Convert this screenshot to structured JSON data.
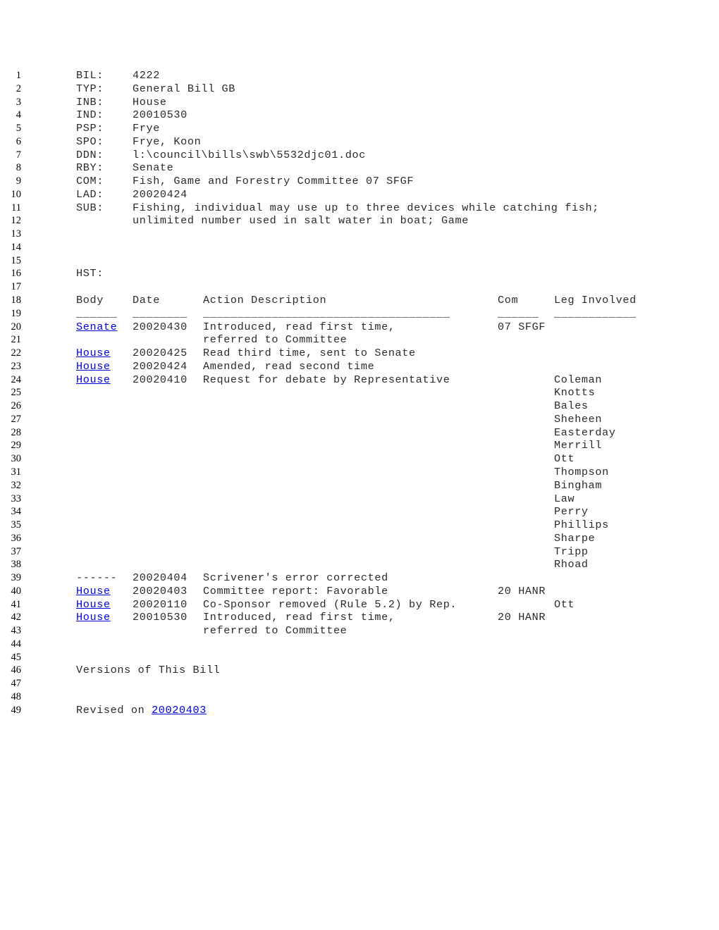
{
  "document": {
    "type": "legislative-bill-status",
    "link_color": "#0000dd",
    "text_color": "#2a2a2a",
    "fields": [
      {
        "no": "1",
        "label": "BIL:",
        "value": "4222"
      },
      {
        "no": "2",
        "label": "TYP:",
        "value": "General Bill GB"
      },
      {
        "no": "3",
        "label": "INB:",
        "value": "House"
      },
      {
        "no": "4",
        "label": "IND:",
        "value": "20010530"
      },
      {
        "no": "5",
        "label": "PSP:",
        "value": "Frye"
      },
      {
        "no": "6",
        "label": "SPO:",
        "value": "Frye, Koon"
      },
      {
        "no": "7",
        "label": "DDN:",
        "value": "l:\\council\\bills\\swb\\5532djc01.doc"
      },
      {
        "no": "8",
        "label": "RBY:",
        "value": "Senate"
      },
      {
        "no": "9",
        "label": "COM:",
        "value": "Fish, Game and Forestry Committee 07 SFGF"
      },
      {
        "no": "10",
        "label": "LAD:",
        "value": "20020424"
      },
      {
        "no": "11",
        "label": "SUB:",
        "value": "Fishing, individual may use up to three devices while catching fish;"
      },
      {
        "no": "12",
        "label": "",
        "value": "unlimited number used in salt water in boat; Game"
      }
    ],
    "blank_lines_a": [
      "13",
      "14",
      "15"
    ],
    "hst": {
      "no": "16",
      "label": "HST:"
    },
    "blank_line_17": "17",
    "table": {
      "header_line_no": "18",
      "headers": {
        "body": "Body",
        "date": "Date",
        "action": "Action Description",
        "com": "Com",
        "leg": "Leg Involved"
      },
      "separator_line_no": "19",
      "separators": {
        "body": "______",
        "date": "________",
        "action": "____________________________________",
        "com": "______",
        "leg": "____________"
      },
      "rows": [
        {
          "no": "20",
          "body": "Senate",
          "body_link": true,
          "date": "20020430",
          "action": "Introduced, read first time,",
          "com": "07 SFGF",
          "leg": ""
        },
        {
          "no": "21",
          "body": "",
          "body_link": false,
          "date": "",
          "action": "referred to Committee",
          "com": "",
          "leg": ""
        },
        {
          "no": "22",
          "body": "House",
          "body_link": true,
          "date": "20020425",
          "action": "Read third time, sent to Senate",
          "com": "",
          "leg": ""
        },
        {
          "no": "23",
          "body": "House",
          "body_link": true,
          "date": "20020424",
          "action": "Amended, read second time",
          "com": "",
          "leg": ""
        },
        {
          "no": "24",
          "body": "House",
          "body_link": true,
          "date": "20020410",
          "action": "Request for debate by Representative",
          "com": "",
          "leg": "Coleman"
        },
        {
          "no": "25",
          "body": "",
          "body_link": false,
          "date": "",
          "action": "",
          "com": "",
          "leg": "Knotts"
        },
        {
          "no": "26",
          "body": "",
          "body_link": false,
          "date": "",
          "action": "",
          "com": "",
          "leg": "Bales"
        },
        {
          "no": "27",
          "body": "",
          "body_link": false,
          "date": "",
          "action": "",
          "com": "",
          "leg": "Sheheen"
        },
        {
          "no": "28",
          "body": "",
          "body_link": false,
          "date": "",
          "action": "",
          "com": "",
          "leg": "Easterday"
        },
        {
          "no": "29",
          "body": "",
          "body_link": false,
          "date": "",
          "action": "",
          "com": "",
          "leg": "Merrill"
        },
        {
          "no": "30",
          "body": "",
          "body_link": false,
          "date": "",
          "action": "",
          "com": "",
          "leg": "Ott"
        },
        {
          "no": "31",
          "body": "",
          "body_link": false,
          "date": "",
          "action": "",
          "com": "",
          "leg": "Thompson"
        },
        {
          "no": "32",
          "body": "",
          "body_link": false,
          "date": "",
          "action": "",
          "com": "",
          "leg": "Bingham"
        },
        {
          "no": "33",
          "body": "",
          "body_link": false,
          "date": "",
          "action": "",
          "com": "",
          "leg": "Law"
        },
        {
          "no": "34",
          "body": "",
          "body_link": false,
          "date": "",
          "action": "",
          "com": "",
          "leg": "Perry"
        },
        {
          "no": "35",
          "body": "",
          "body_link": false,
          "date": "",
          "action": "",
          "com": "",
          "leg": "Phillips"
        },
        {
          "no": "36",
          "body": "",
          "body_link": false,
          "date": "",
          "action": "",
          "com": "",
          "leg": "Sharpe"
        },
        {
          "no": "37",
          "body": "",
          "body_link": false,
          "date": "",
          "action": "",
          "com": "",
          "leg": "Tripp"
        },
        {
          "no": "38",
          "body": "",
          "body_link": false,
          "date": "",
          "action": "",
          "com": "",
          "leg": "Rhoad"
        },
        {
          "no": "39",
          "body": "------",
          "body_link": false,
          "date": "20020404",
          "action": "Scrivener's error corrected",
          "com": "",
          "leg": ""
        },
        {
          "no": "40",
          "body": "House",
          "body_link": true,
          "date": "20020403",
          "action": "Committee report: Favorable",
          "com": "20 HANR",
          "leg": ""
        },
        {
          "no": "41",
          "body": "House",
          "body_link": true,
          "date": "20020110",
          "action": "Co-Sponsor removed (Rule 5.2) by Rep.",
          "com": "",
          "leg": "Ott"
        },
        {
          "no": "42",
          "body": "House",
          "body_link": true,
          "date": "20010530",
          "action": "Introduced, read first time,",
          "com": "20 HANR",
          "leg": ""
        },
        {
          "no": "43",
          "body": "",
          "body_link": false,
          "date": "",
          "action": "referred to Committee",
          "com": "",
          "leg": ""
        }
      ]
    },
    "blank_lines_b": [
      "44",
      "45"
    ],
    "versions": {
      "no": "46",
      "text": "Versions of This Bill"
    },
    "blank_lines_c": [
      "47",
      "48"
    ],
    "revised": {
      "no": "49",
      "prefix": "Revised on ",
      "date_link": "20020403"
    }
  }
}
